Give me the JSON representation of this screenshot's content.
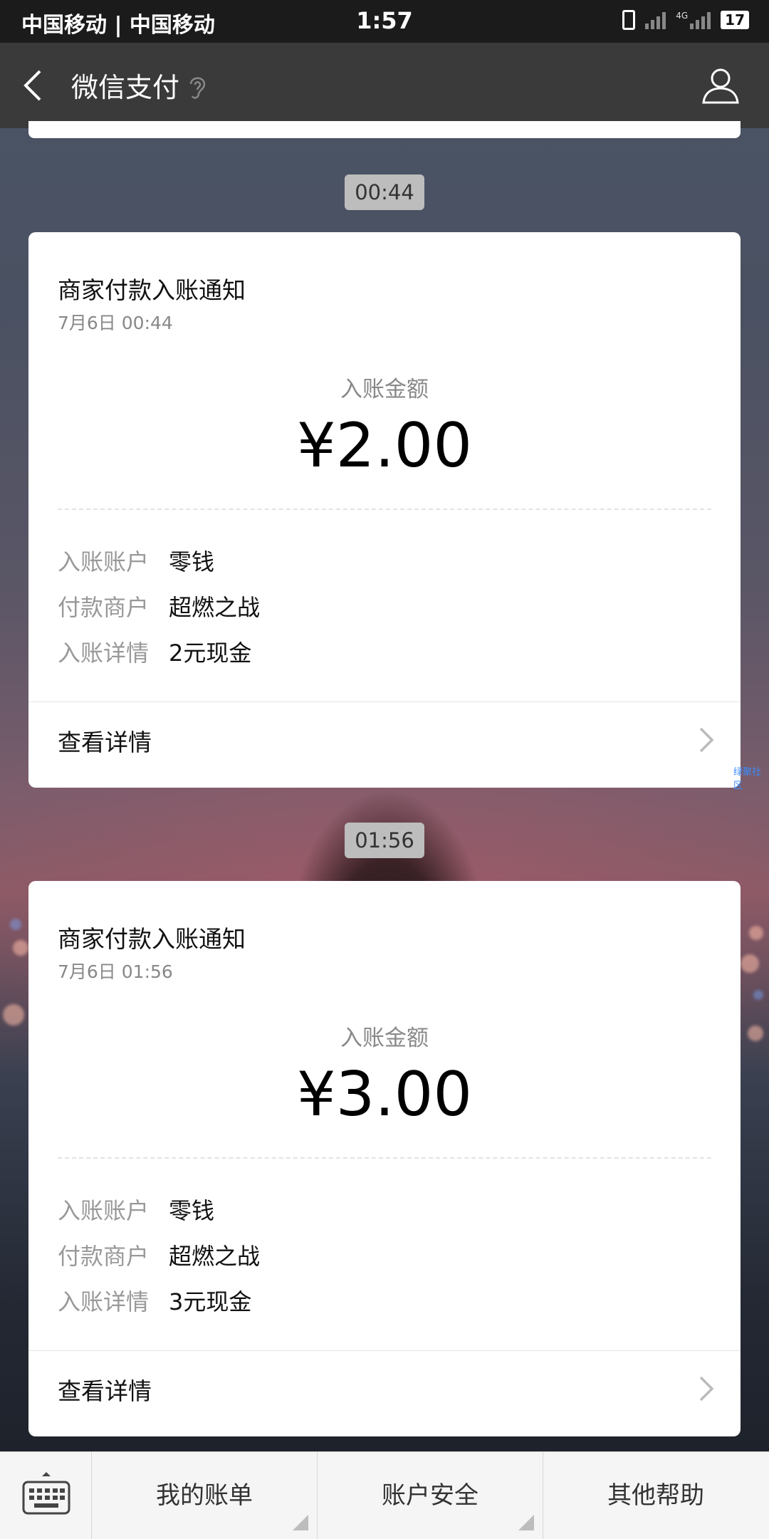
{
  "status": {
    "carrier": "中国移动 | 中国移动",
    "time": "1:57",
    "net": "4G",
    "battery": "17"
  },
  "nav": {
    "title": "微信支付"
  },
  "messages": [
    {
      "timestamp": "00:44",
      "title": "商家付款入账通知",
      "date": "7月6日  00:44",
      "amount_label": "入账金额",
      "amount": "¥2.00",
      "rows": [
        {
          "k": "入账账户",
          "v": "零钱"
        },
        {
          "k": "付款商户",
          "v": "超燃之战"
        },
        {
          "k": "入账详情",
          "v": "2元现金"
        }
      ],
      "detail": "查看详情"
    },
    {
      "timestamp": "01:56",
      "title": "商家付款入账通知",
      "date": "7月6日  01:56",
      "amount_label": "入账金额",
      "amount": "¥3.00",
      "rows": [
        {
          "k": "入账账户",
          "v": "零钱"
        },
        {
          "k": "付款商户",
          "v": "超燃之战"
        },
        {
          "k": "入账详情",
          "v": "3元现金"
        }
      ],
      "detail": "查看详情"
    }
  ],
  "watermark": "绿聚社区",
  "bottom_menu": [
    "我的账单",
    "账户安全",
    "其他帮助"
  ]
}
